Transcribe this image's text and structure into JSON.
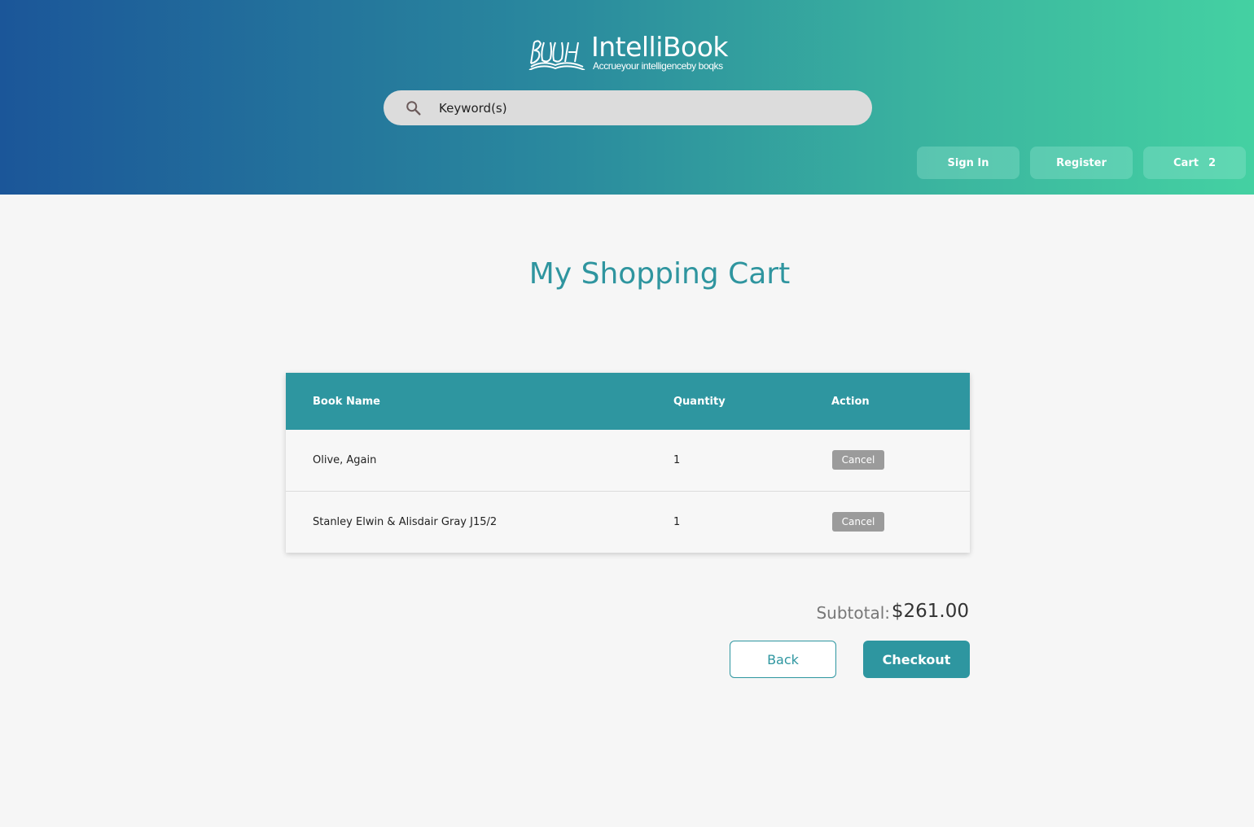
{
  "brand": {
    "name": "IntelliBook",
    "tagline": "Accrueyour intelligenceby boqks"
  },
  "search": {
    "placeholder": "Keyword(s)",
    "icon": "search-icon"
  },
  "nav": {
    "sign_in": "Sign In",
    "register": "Register",
    "cart_label": "Cart",
    "cart_count": "2"
  },
  "page": {
    "title": "My Shopping Cart"
  },
  "cart_table": {
    "headers": {
      "book_name": "Book Name",
      "quantity": "Quantity",
      "action": "Action"
    },
    "rows": [
      {
        "book_name": "Olive, Again",
        "quantity": "1",
        "action": "Cancel"
      },
      {
        "book_name": "Stanley Elwin & Alisdair Gray J15/2",
        "quantity": "1",
        "action": "Cancel"
      }
    ]
  },
  "summary": {
    "subtotal_label": "Subtotal:",
    "subtotal_value": "$261.00"
  },
  "actions": {
    "back": "Back",
    "checkout": "Checkout"
  },
  "colors": {
    "accent": "#2e96a0",
    "header_gradient_start": "#1b5699",
    "header_gradient_end": "#44d1a2",
    "cancel_button": "#9b9b9b"
  }
}
